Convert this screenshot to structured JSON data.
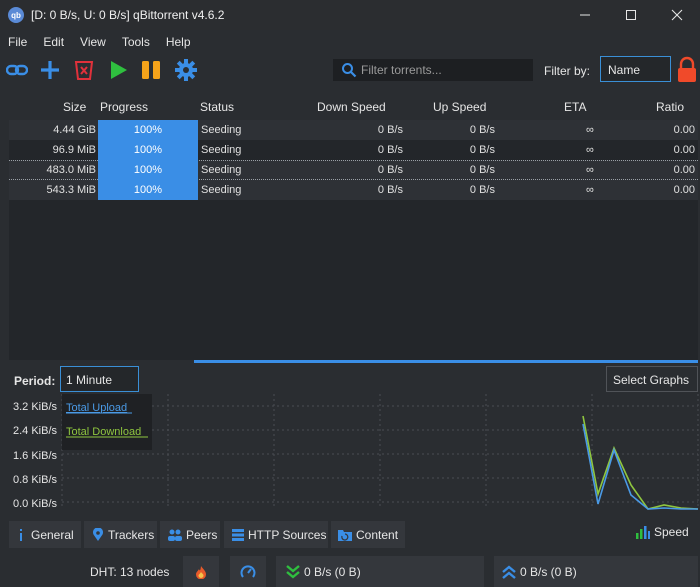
{
  "window": {
    "logo_text": "qb",
    "title": "[D: 0 B/s, U: 0 B/s] qBittorrent v4.6.2"
  },
  "menu": [
    "File",
    "Edit",
    "View",
    "Tools",
    "Help"
  ],
  "toolbar": {
    "search_placeholder": "Filter torrents...",
    "filter_label": "Filter by:",
    "filter_value": "Name"
  },
  "table": {
    "columns": [
      "Size",
      "Progress",
      "Status",
      "Down Speed",
      "Up Speed",
      "ETA",
      "Ratio"
    ],
    "rows": [
      {
        "size": "4.44 GiB",
        "progress": "100%",
        "status": "Seeding",
        "down": "0 B/s",
        "up": "0 B/s",
        "eta": "∞",
        "ratio": "0.00"
      },
      {
        "size": "96.9 MiB",
        "progress": "100%",
        "status": "Seeding",
        "down": "0 B/s",
        "up": "0 B/s",
        "eta": "∞",
        "ratio": "0.00"
      },
      {
        "size": "483.0 MiB",
        "progress": "100%",
        "status": "Seeding",
        "down": "0 B/s",
        "up": "0 B/s",
        "eta": "∞",
        "ratio": "0.00"
      },
      {
        "size": "543.3 MiB",
        "progress": "100%",
        "status": "Seeding",
        "down": "0 B/s",
        "up": "0 B/s",
        "eta": "∞",
        "ratio": "0.00"
      }
    ]
  },
  "graph": {
    "period_label": "Period:",
    "period_value": "1 Minute",
    "select_graphs_label": "Select Graphs",
    "y_labels": [
      "3.2 KiB/s",
      "2.4 KiB/s",
      "1.6 KiB/s",
      "0.8 KiB/s",
      "0.0 KiB/s"
    ],
    "legend_upload": "Total Upload",
    "legend_download": "Total Download",
    "upload_color": "#4a9ae6",
    "download_color": "#8fc63f"
  },
  "tabs": [
    "General",
    "Trackers",
    "Peers",
    "HTTP Sources",
    "Content"
  ],
  "speed_tab": "Speed",
  "status": {
    "dht": "DHT: 13 nodes",
    "download": "0 B/s (0 B)",
    "upload": "0 B/s (0 B)"
  },
  "colors": {
    "accent": "#3a8ee6",
    "play": "#2fbf3f",
    "pause": "#f5a31a",
    "delete": "#e0313b",
    "lock": "#f04a2a"
  }
}
